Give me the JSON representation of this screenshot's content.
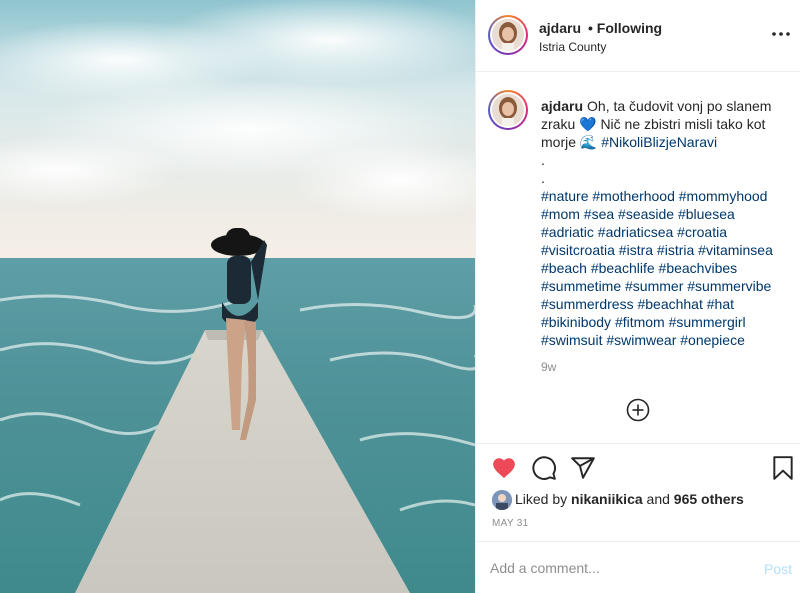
{
  "post": {
    "username": "ajdaru",
    "follow_status": "• Following",
    "location": "Istria County",
    "caption": {
      "username": "ajdaru",
      "lines": [
        "Oh, ta čudovit vonj po slanem",
        "zraku 💙 Nič ne zbistri misli tako kot",
        "morje 🌊 #NikoliBlizjeNaravi",
        ".",
        ".",
        "#nature #motherhood #mommyhood",
        "#mom #sea #seaside #bluesea",
        "#adriatic #adriaticsea #croatia",
        "#visitcroatia #istra #istria #vitaminsea",
        "#beach #beachlife #beachvibes",
        "#summetime #summer #summervibe",
        "#summerdress #beachhat #hat",
        "#bikinibody #fitmom #summergirl",
        "#swimsuit #swimwear #onepiece"
      ]
    },
    "time_ago": "9w",
    "likes": {
      "prefix": "Liked by",
      "user": "nikaniikica",
      "middle": "and",
      "others": "965 others"
    },
    "date": "MAY 31",
    "comment_placeholder": "Add a comment...",
    "post_button": "Post"
  },
  "icons": {
    "more": "more-options-icon",
    "load_more": "add-circle-icon",
    "like": "heart-icon",
    "comment": "comment-icon",
    "share": "share-icon",
    "save": "bookmark-icon"
  },
  "colors": {
    "like": "#ed4956",
    "hashtag": "#00376b",
    "secondary_text": "#8e8e8e",
    "post_disabled": "#b2dffc"
  }
}
